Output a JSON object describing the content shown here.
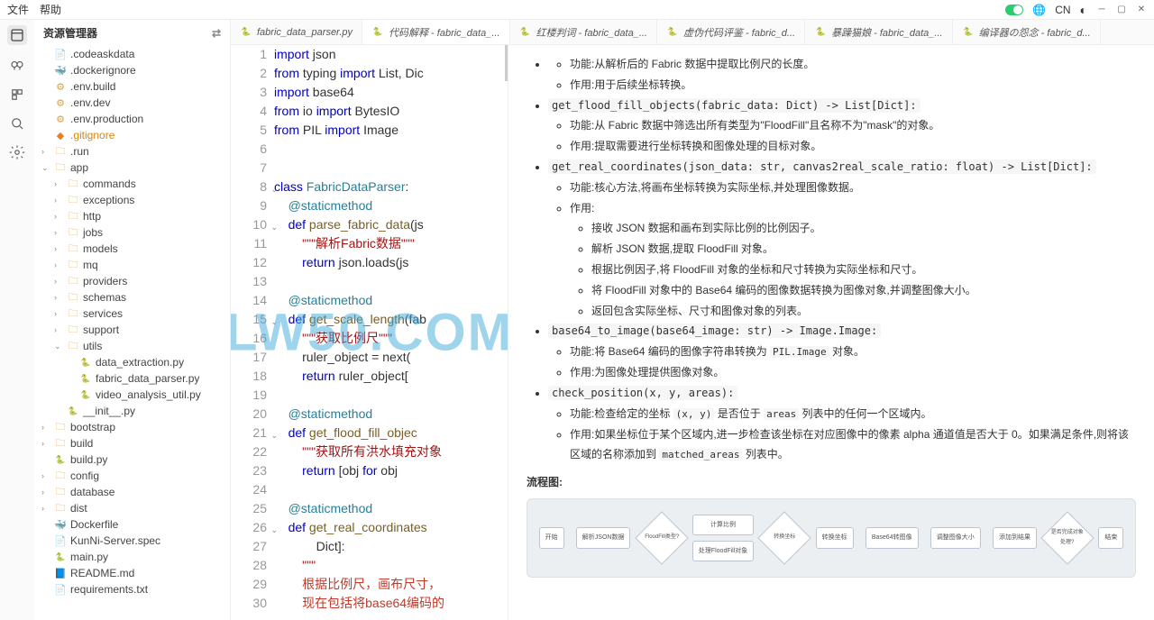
{
  "menu": {
    "file": "文件",
    "help": "帮助",
    "lang": "CN"
  },
  "sidebar": {
    "title": "资源管理器",
    "items": [
      {
        "t": "file",
        "name": ".codeaskdata",
        "icon": "txt",
        "d": 0
      },
      {
        "t": "file",
        "name": ".dockerignore",
        "icon": "docker",
        "d": 0
      },
      {
        "t": "file",
        "name": ".env.build",
        "icon": "env",
        "d": 0
      },
      {
        "t": "file",
        "name": ".env.dev",
        "icon": "env",
        "d": 0
      },
      {
        "t": "file",
        "name": ".env.production",
        "icon": "env",
        "d": 0
      },
      {
        "t": "file",
        "name": ".gitignore",
        "icon": "git",
        "d": 0,
        "orange": true
      },
      {
        "t": "folder",
        "name": ".run",
        "d": 0,
        "open": false
      },
      {
        "t": "folder",
        "name": "app",
        "d": 0,
        "open": true
      },
      {
        "t": "folder",
        "name": "commands",
        "d": 1,
        "open": false
      },
      {
        "t": "folder",
        "name": "exceptions",
        "d": 1,
        "open": false
      },
      {
        "t": "folder",
        "name": "http",
        "d": 1,
        "open": false
      },
      {
        "t": "folder",
        "name": "jobs",
        "d": 1,
        "open": false
      },
      {
        "t": "folder",
        "name": "models",
        "d": 1,
        "open": false
      },
      {
        "t": "folder",
        "name": "mq",
        "d": 1,
        "open": false
      },
      {
        "t": "folder",
        "name": "providers",
        "d": 1,
        "open": false
      },
      {
        "t": "folder",
        "name": "schemas",
        "d": 1,
        "open": false
      },
      {
        "t": "folder",
        "name": "services",
        "d": 1,
        "open": false
      },
      {
        "t": "folder",
        "name": "support",
        "d": 1,
        "open": false
      },
      {
        "t": "folder",
        "name": "utils",
        "d": 1,
        "open": true
      },
      {
        "t": "file",
        "name": "data_extraction.py",
        "icon": "py",
        "d": 2
      },
      {
        "t": "file",
        "name": "fabric_data_parser.py",
        "icon": "py",
        "d": 2
      },
      {
        "t": "file",
        "name": "video_analysis_util.py",
        "icon": "py",
        "d": 2
      },
      {
        "t": "file",
        "name": "__init__.py",
        "icon": "py",
        "d": 1
      },
      {
        "t": "folder",
        "name": "bootstrap",
        "d": 0,
        "open": false
      },
      {
        "t": "folder",
        "name": "build",
        "d": 0,
        "open": false
      },
      {
        "t": "file",
        "name": "build.py",
        "icon": "py",
        "d": 0
      },
      {
        "t": "folder",
        "name": "config",
        "d": 0,
        "open": false
      },
      {
        "t": "folder",
        "name": "database",
        "d": 0,
        "open": false
      },
      {
        "t": "folder",
        "name": "dist",
        "d": 0,
        "open": false
      },
      {
        "t": "file",
        "name": "Dockerfile",
        "icon": "docker",
        "d": 0
      },
      {
        "t": "file",
        "name": "KunNi-Server.spec",
        "icon": "txt",
        "d": 0
      },
      {
        "t": "file",
        "name": "main.py",
        "icon": "py",
        "d": 0
      },
      {
        "t": "file",
        "name": "README.md",
        "icon": "readme",
        "d": 0
      },
      {
        "t": "file",
        "name": "requirements.txt",
        "icon": "txt",
        "d": 0
      }
    ]
  },
  "tabs": [
    {
      "label": "fabric_data_parser.py",
      "icon": "py"
    },
    {
      "label": "代码解释 - fabric_data_...",
      "icon": "py",
      "active": true
    },
    {
      "label": "红楼判词 - fabric_data_...",
      "icon": "py"
    },
    {
      "label": "虚伪代码评鉴 - fabric_d...",
      "icon": "py"
    },
    {
      "label": "暴躁猫娘 - fabric_data_...",
      "icon": "py"
    },
    {
      "label": "编译器の怨念 - fabric_d...",
      "icon": "py"
    }
  ],
  "code": {
    "lines": [
      {
        "n": 1,
        "h": "<span class='kw'>import</span> json"
      },
      {
        "n": 2,
        "h": "<span class='kw'>from</span> typing <span class='kw'>import</span> List, Dic"
      },
      {
        "n": 3,
        "h": "<span class='kw'>import</span> base64"
      },
      {
        "n": 4,
        "h": "<span class='kw'>from</span> io <span class='kw'>import</span> BytesIO"
      },
      {
        "n": 5,
        "h": "<span class='kw'>from</span> PIL <span class='kw'>import</span> Image"
      },
      {
        "n": 6,
        "h": ""
      },
      {
        "n": 7,
        "h": ""
      },
      {
        "n": 8,
        "h": "<span class='kw'>class</span> <span class='cls'>FabricDataParser</span>:",
        "fold": true
      },
      {
        "n": 9,
        "h": "    <span class='dec'>@staticmethod</span>"
      },
      {
        "n": 10,
        "h": "    <span class='kw'>def</span> <span class='fn'>parse_fabric_data</span>(js",
        "fold": true
      },
      {
        "n": 11,
        "h": "        <span class='doc'>&quot;&quot;&quot;解析Fabric数据&quot;&quot;&quot;</span>"
      },
      {
        "n": 12,
        "h": "        <span class='kw'>return</span> json.loads(js"
      },
      {
        "n": 13,
        "h": ""
      },
      {
        "n": 14,
        "h": "    <span class='dec'>@staticmethod</span>"
      },
      {
        "n": 15,
        "h": "    <span class='kw'>def</span> <span class='fn'>get_scale_length</span>(fab",
        "fold": true
      },
      {
        "n": 16,
        "h": "        <span class='doc'>&quot;&quot;&quot;获取比例尺&quot;&quot;&quot;</span>"
      },
      {
        "n": 17,
        "h": "        ruler_object = next("
      },
      {
        "n": 18,
        "h": "        <span class='kw'>return</span> ruler_object["
      },
      {
        "n": 19,
        "h": ""
      },
      {
        "n": 20,
        "h": "    <span class='dec'>@staticmethod</span>"
      },
      {
        "n": 21,
        "h": "    <span class='kw'>def</span> <span class='fn'>get_flood_fill_objec</span>",
        "fold": true
      },
      {
        "n": 22,
        "h": "        <span class='doc'>&quot;&quot;&quot;获取所有洪水填充对象</span>"
      },
      {
        "n": 23,
        "h": "        <span class='kw'>return</span> [obj <span class='kw'>for</span> obj "
      },
      {
        "n": 24,
        "h": ""
      },
      {
        "n": 25,
        "h": "    <span class='dec'>@staticmethod</span>"
      },
      {
        "n": 26,
        "h": "    <span class='kw'>def</span> <span class='fn'>get_real_coordinates</span>",
        "fold": true
      },
      {
        "n": 27,
        "h": "            Dict]:"
      },
      {
        "n": 28,
        "h": "        <span class='doc'>&quot;&quot;&quot;</span>"
      },
      {
        "n": 29,
        "h": "        <span class='doc-special'>根据比例尺，画布尺寸，</span>"
      },
      {
        "n": 30,
        "h": "        <span class='doc-special'>现在包括将base64编码的</span>"
      }
    ]
  },
  "doc": {
    "intro": [
      "功能:从解析后的 Fabric 数据中提取比例尺的长度。",
      "作用:用于后续坐标转换。"
    ],
    "s1_sig": "get_flood_fill_objects(fabric_data: Dict) -> List[Dict]:",
    "s1_items": [
      "功能:从 Fabric 数据中筛选出所有类型为\"FloodFill\"且名称不为\"mask\"的对象。",
      "作用:提取需要进行坐标转换和图像处理的目标对象。"
    ],
    "s2_sig": "get_real_coordinates(json_data: str, canvas2real_scale_ratio: float) -> List[Dict]:",
    "s2_items": [
      "功能:核心方法,将画布坐标转换为实际坐标,并处理图像数据。",
      "作用:"
    ],
    "s2_sub": [
      "接收 JSON 数据和画布到实际比例的比例因子。",
      "解析 JSON 数据,提取 FloodFill 对象。",
      "根据比例因子,将 FloodFill 对象的坐标和尺寸转换为实际坐标和尺寸。",
      "将 FloodFill 对象中的 Base64 编码的图像数据转换为图像对象,并调整图像大小。",
      "返回包含实际坐标、尺寸和图像对象的列表。"
    ],
    "s3_sig": "base64_to_image(base64_image: str) -> Image.Image:",
    "s3_a": "功能:将 Base64 编码的图像字符串转换为 ",
    "s3_code": "PIL.Image",
    "s3_b": " 对象。",
    "s3_c": "作用:为图像处理提供图像对象。",
    "s4_sig": "check_position(x, y, areas):",
    "s4_a1": "功能:检查给定的坐标 ",
    "s4_code1": "(x, y)",
    "s4_a2": " 是否位于 ",
    "s4_code2": "areas",
    "s4_a3": " 列表中的任何一个区域内。",
    "s4_b1": "作用:如果坐标位于某个区域内,进一步检查该坐标在对应图像中的像素 alpha 通道值是否大于 0。如果满足条件,则将该区域的名称添加到 ",
    "s4_code3": "matched_areas",
    "s4_b2": " 列表中。",
    "flow_label": "流程图:",
    "flow": [
      "开始",
      "解析JSON数据",
      "FloodFill类型?",
      "计算比例",
      "转换坐标",
      "处理FloodFill对象",
      "Base64转图像",
      "调整图像大小",
      "添加到结果",
      "是否完成对象处理?",
      "结束"
    ]
  },
  "watermark": "LW50.COM"
}
